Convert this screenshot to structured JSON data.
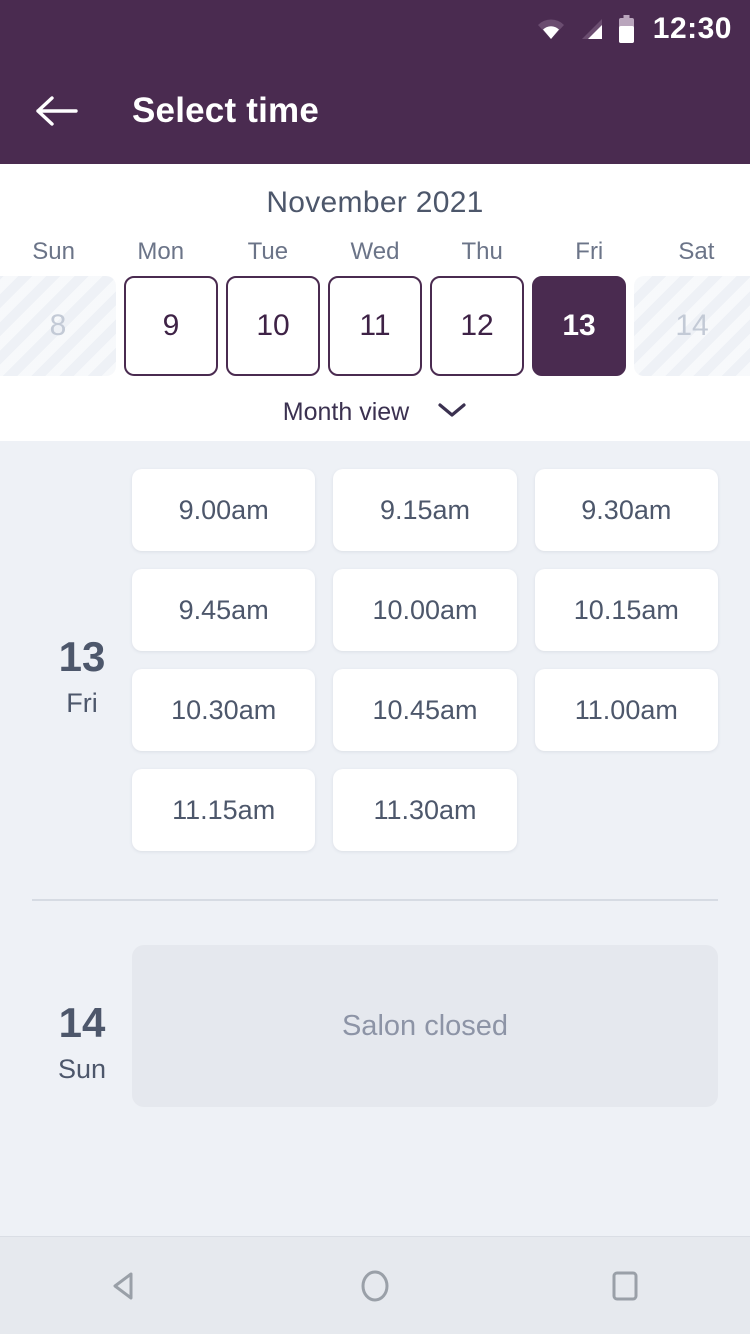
{
  "statusbar": {
    "clock": "12:30",
    "icons": [
      "wifi-icon",
      "cell-signal-icon",
      "battery-icon"
    ]
  },
  "appbar": {
    "back_icon": "arrow-left-icon",
    "title": "Select time"
  },
  "calendar": {
    "month_label": "November 2021",
    "weekdays": [
      "Sun",
      "Mon",
      "Tue",
      "Wed",
      "Thu",
      "Fri",
      "Sat"
    ],
    "days": [
      {
        "num": "8",
        "state": "disabled"
      },
      {
        "num": "9",
        "state": "enabled"
      },
      {
        "num": "10",
        "state": "enabled"
      },
      {
        "num": "11",
        "state": "enabled"
      },
      {
        "num": "12",
        "state": "enabled"
      },
      {
        "num": "13",
        "state": "selected"
      },
      {
        "num": "14",
        "state": "disabled"
      }
    ],
    "view_toggle": {
      "label": "Month view",
      "icon": "chevron-down-icon"
    }
  },
  "schedule": [
    {
      "day_num": "13",
      "day_of_week": "Fri",
      "slots": [
        "9.00am",
        "9.15am",
        "9.30am",
        "9.45am",
        "10.00am",
        "10.15am",
        "10.30am",
        "10.45am",
        "11.00am",
        "11.15am",
        "11.30am"
      ]
    },
    {
      "day_num": "14",
      "day_of_week": "Sun",
      "closed_message": "Salon closed"
    }
  ],
  "navbar": {
    "back": "nav-back-icon",
    "home": "nav-home-icon",
    "recents": "nav-recents-icon"
  },
  "colors": {
    "header_purple": "#4a2b50",
    "body_bg": "#eef1f6",
    "slot_text": "#4d576b",
    "disabled_text": "#c3cad6"
  }
}
